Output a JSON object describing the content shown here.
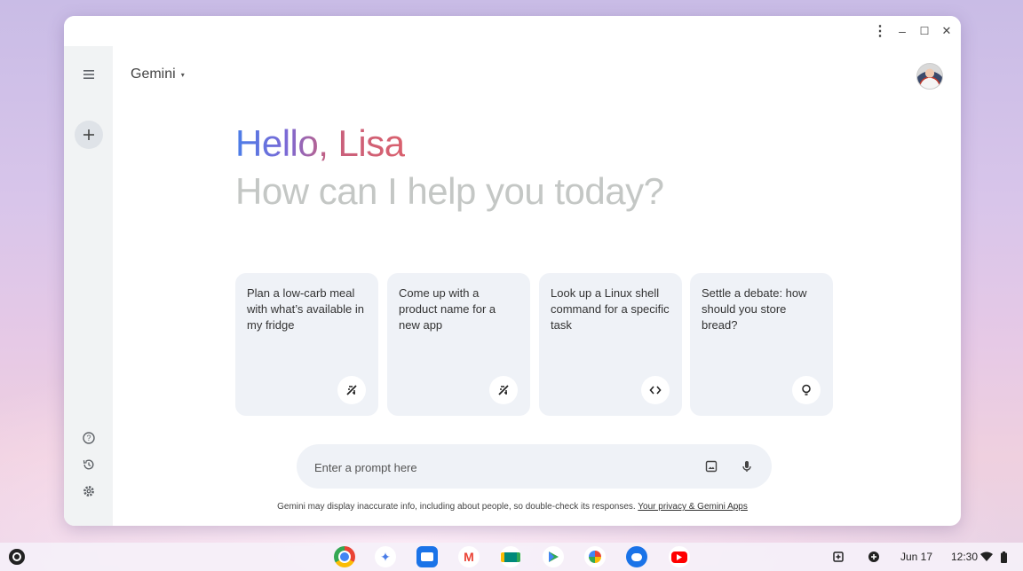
{
  "window": {
    "controls": {
      "menu": "⋮",
      "minimize": "–",
      "maximize": "☐",
      "close": "✕"
    }
  },
  "header": {
    "app_title": "Gemini",
    "caret": "▾"
  },
  "sidebar": {
    "menu_icon": "menu-icon",
    "new_chat_icon": "plus-icon",
    "bottom_icons": [
      "help-icon",
      "history-icon",
      "settings-icon"
    ]
  },
  "greeting": {
    "hello": "Hello, Lisa",
    "subtitle": "How can I help you today?"
  },
  "cards": [
    {
      "text": "Plan a low-carb meal with what’s available in my fridge",
      "icon": "compass-icon"
    },
    {
      "text": "Come up with a product name for a new app",
      "icon": "compass-icon"
    },
    {
      "text": "Look up a Linux shell command for a specific task",
      "icon": "code-icon"
    },
    {
      "text": "Settle a debate: how should you store bread?",
      "icon": "lightbulb-icon"
    }
  ],
  "prompt": {
    "placeholder": "Enter a prompt here",
    "image_icon": "image-upload-icon",
    "mic_icon": "mic-icon"
  },
  "disclaimer": {
    "text": "Gemini may display inaccurate info, including about people, so double-check its responses.",
    "link": "Your privacy & Gemini Apps"
  },
  "shelf": {
    "apps": [
      "Chrome",
      "Gemini",
      "Files",
      "Gmail",
      "Meet",
      "Play Store",
      "Photos",
      "Messages",
      "YouTube"
    ],
    "date": "Jun 17",
    "time": "12:30"
  },
  "colors": {
    "accent_blue": "#4a7de8",
    "accent_red": "#d9606d",
    "card_bg": "#eff2f7",
    "sidebar_bg": "#f1f3f4"
  }
}
